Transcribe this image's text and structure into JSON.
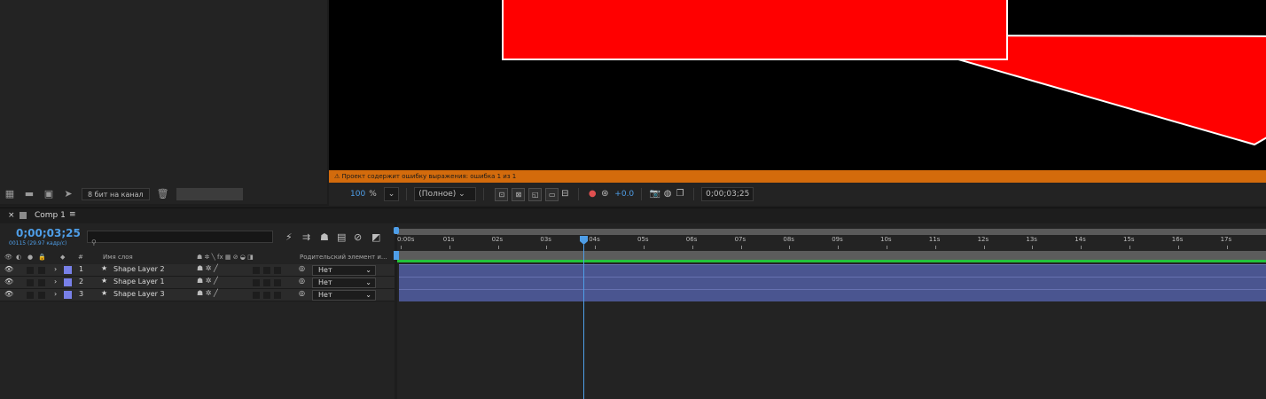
{
  "project_toolbar": {
    "bit_label": "8 бит на канал"
  },
  "viewer": {
    "warning": "Проект содержит ошибку выражения: ошибка 1 из 1"
  },
  "viewer_toolbar": {
    "zoom": "100",
    "zoom_unit": "%",
    "resolution": "(Полное)",
    "exposure": "+0.0",
    "timecode": "0;00;03;25"
  },
  "timeline": {
    "tab_label": "Comp 1",
    "timecode": "0;00;03;25",
    "fps": "00115 (29.97 кадр/с)",
    "search_placeholder": "",
    "col_num": "#",
    "col_name": "Имя слоя",
    "col_parent": "Родительский элемент и...",
    "layers": [
      {
        "num": "1",
        "name": "Shape Layer 2",
        "parent": "Нет"
      },
      {
        "num": "2",
        "name": "Shape Layer 1",
        "parent": "Нет"
      },
      {
        "num": "3",
        "name": "Shape Layer 3",
        "parent": "Нет"
      }
    ],
    "ruler": [
      "0:00s",
      "01s",
      "02s",
      "03s",
      "04s",
      "05s",
      "06s",
      "07s",
      "08s",
      "09s",
      "10s",
      "11s",
      "12s",
      "13s",
      "14s",
      "15s",
      "16s",
      "17s"
    ]
  },
  "colors": {
    "accent": "#4e9ee8",
    "warning": "#d36b0c",
    "layer_bar": "#4a5590",
    "shape": "#ff0000",
    "work_area": "#22c33a"
  }
}
